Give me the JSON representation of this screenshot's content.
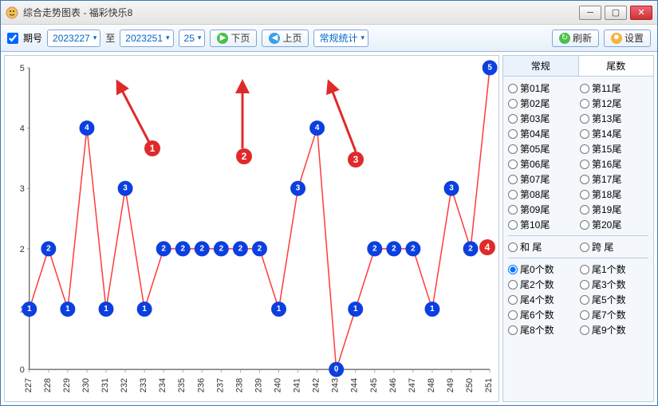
{
  "window": {
    "title": "综合走势图表 - 福彩快乐8"
  },
  "toolbar": {
    "period_label": "期号",
    "start": "2023227",
    "to": "至",
    "end": "2023251",
    "count": "25",
    "next_page": "下页",
    "prev_page": "上页",
    "stats": "常规统计",
    "refresh": "刷新",
    "settings": "设置"
  },
  "tabs": {
    "normal": "常规",
    "tail": "尾数"
  },
  "side": {
    "tail_options_left": [
      "第01尾",
      "第02尾",
      "第03尾",
      "第04尾",
      "第05尾",
      "第06尾",
      "第07尾",
      "第08尾",
      "第09尾",
      "第10尾"
    ],
    "tail_options_right": [
      "第11尾",
      "第12尾",
      "第13尾",
      "第14尾",
      "第15尾",
      "第16尾",
      "第17尾",
      "第18尾",
      "第19尾",
      "第20尾"
    ],
    "sum_tail": "和 尾",
    "span_tail": "跨 尾",
    "count_options_left": [
      "尾0个数",
      "尾2个数",
      "尾4个数",
      "尾6个数",
      "尾8个数"
    ],
    "count_options_right": [
      "尾1个数",
      "尾3个数",
      "尾5个数",
      "尾7个数",
      "尾9个数"
    ],
    "selected": "尾0个数"
  },
  "callouts": {
    "c1": "1",
    "c2": "2",
    "c3": "3",
    "c4": "4"
  },
  "chart_data": {
    "type": "line",
    "title": "",
    "xlabel": "",
    "ylabel": "",
    "ylim": [
      0,
      5
    ],
    "categories": [
      "227",
      "228",
      "229",
      "230",
      "231",
      "232",
      "233",
      "234",
      "235",
      "236",
      "237",
      "238",
      "239",
      "240",
      "241",
      "242",
      "243",
      "244",
      "245",
      "246",
      "247",
      "248",
      "249",
      "250",
      "251"
    ],
    "values": [
      1,
      2,
      1,
      4,
      1,
      3,
      1,
      2,
      2,
      2,
      2,
      2,
      2,
      1,
      3,
      4,
      0,
      1,
      2,
      2,
      2,
      1,
      3,
      2,
      5
    ]
  }
}
